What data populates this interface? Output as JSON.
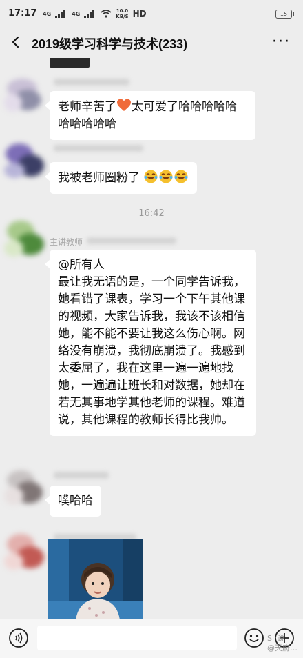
{
  "status_bar": {
    "time": "17:17",
    "net1": "4G",
    "net2": "4G",
    "speed_value": "10.0",
    "speed_unit": "KB/S",
    "hd": "HD",
    "battery": "15"
  },
  "header": {
    "title": "2019级学习科学与技术(233)",
    "more": "···"
  },
  "messages": [
    {
      "text_part1": "老师辛苦了",
      "emoji": "heart-icon",
      "text_part2": "太可爱了哈哈哈哈哈哈哈哈哈哈"
    },
    {
      "text": "我被老师圈粉了",
      "emoji": "laugh-cry-icon"
    },
    {
      "timestamp": "16:42"
    },
    {
      "sender": "主讲教师",
      "mention": "@所有人",
      "text": "最让我无语的是，一个同学告诉我，她看错了课表，学习一个下午其他课的视频，大家告诉我，我该不该相信她，能不能不要让我这么伤心啊。网络没有崩溃，我彻底崩溃了。我感到太委屈了，我在这里一遍一遍地找她，一遍遍让班长和对数据，她却在若无其事地学其他老师的课程。难道说，其他课程的教师长得比我帅。"
    },
    {
      "text": "噗哈哈"
    }
  ],
  "watermark": {
    "line1": "Sir说",
    "line2": "@天府…"
  },
  "colors": {
    "background": "#ededed",
    "bubble": "#ffffff",
    "heart": "#f06b3a"
  }
}
